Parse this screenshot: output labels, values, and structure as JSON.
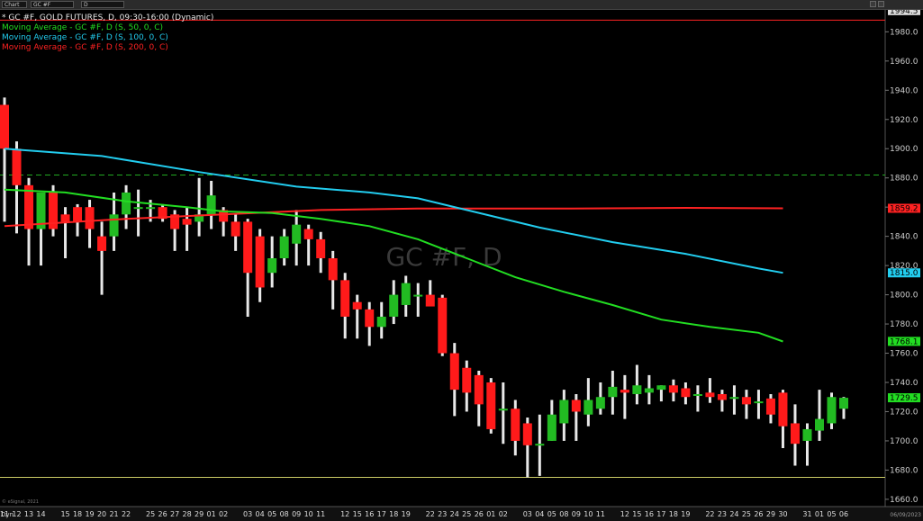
{
  "toolbar": {
    "chart_label": "Chart",
    "symbol": "GC #F",
    "interval": "D"
  },
  "legend": {
    "title": "* GC #F, GOLD FUTURES, D, 09:30-16:00 (Dynamic)",
    "ma50": "Moving Average - GC #F, D (S, 50, 0, C)",
    "ma100": "Moving Average - GC #F, D (S, 100, 0, C)",
    "ma200": "Moving Average - GC #F, D (S, 200, 0, C)"
  },
  "watermark": "GC #F, D",
  "copyright": "© eSignal, 2021",
  "footer": {
    "left": "Dyn",
    "right": "06/09/2023"
  },
  "price_tags": {
    "top": "1994.5",
    "ma200": "1859.2",
    "ma100": "1815.0",
    "ma50": "1768.1",
    "last": "1729.5"
  },
  "colors": {
    "up": "#22bb22",
    "down": "#ff1a1a",
    "wick": "#e8e8e8",
    "ma50": "#22dd22",
    "ma100": "#22ccee",
    "ma200": "#ff2222",
    "level_green": "#22aa22",
    "level_red": "#ff2222",
    "level_yellow": "#cccc66"
  },
  "chart_data": {
    "type": "candlestick",
    "ylim": [
      1655,
      1995
    ],
    "y_ticks": [
      1660,
      1680,
      1700,
      1720,
      1740,
      1760,
      1780,
      1800,
      1820,
      1840,
      1860,
      1880,
      1900,
      1920,
      1940,
      1960,
      1980
    ],
    "x_labels": [
      "11",
      "12",
      "13",
      "14",
      "15",
      "18",
      "19",
      "20",
      "21",
      "22",
      "25",
      "26",
      "27",
      "28",
      "29",
      "01",
      "02",
      "03",
      "04",
      "05",
      "08",
      "09",
      "10",
      "11",
      "12",
      "15",
      "16",
      "17",
      "18",
      "19",
      "22",
      "23",
      "24",
      "25",
      "26",
      "01",
      "02",
      "03",
      "04",
      "05",
      "08",
      "09",
      "10",
      "11",
      "12",
      "15",
      "16",
      "17",
      "18",
      "19",
      "22",
      "23",
      "24",
      "25",
      "26",
      "29",
      "30",
      "31",
      "01",
      "05",
      "06"
    ],
    "candles": [
      {
        "o": 1930,
        "h": 1935,
        "l": 1850,
        "c": 1900
      },
      {
        "o": 1900,
        "h": 1905,
        "l": 1842,
        "c": 1875
      },
      {
        "o": 1875,
        "h": 1880,
        "l": 1820,
        "c": 1845
      },
      {
        "o": 1845,
        "h": 1860,
        "l": 1820,
        "c": 1870
      },
      {
        "o": 1870,
        "h": 1875,
        "l": 1840,
        "c": 1845
      },
      {
        "o": 1855,
        "h": 1860,
        "l": 1825,
        "c": 1850
      },
      {
        "o": 1860,
        "h": 1862,
        "l": 1840,
        "c": 1850
      },
      {
        "o": 1860,
        "h": 1865,
        "l": 1832,
        "c": 1845
      },
      {
        "o": 1840,
        "h": 1850,
        "l": 1800,
        "c": 1830
      },
      {
        "o": 1840,
        "h": 1870,
        "l": 1830,
        "c": 1855
      },
      {
        "o": 1855,
        "h": 1875,
        "l": 1845,
        "c": 1870
      },
      {
        "o": 1860,
        "h": 1872,
        "l": 1840,
        "c": 1860
      },
      {
        "o": 1860,
        "h": 1865,
        "l": 1850,
        "c": 1860
      },
      {
        "o": 1860,
        "h": 1862,
        "l": 1850,
        "c": 1852
      },
      {
        "o": 1855,
        "h": 1858,
        "l": 1830,
        "c": 1845
      },
      {
        "o": 1852,
        "h": 1860,
        "l": 1830,
        "c": 1848
      },
      {
        "o": 1850,
        "h": 1880,
        "l": 1840,
        "c": 1855
      },
      {
        "o": 1855,
        "h": 1878,
        "l": 1845,
        "c": 1868
      },
      {
        "o": 1858,
        "h": 1860,
        "l": 1840,
        "c": 1850
      },
      {
        "o": 1850,
        "h": 1855,
        "l": 1830,
        "c": 1840
      },
      {
        "o": 1850,
        "h": 1852,
        "l": 1785,
        "c": 1815
      },
      {
        "o": 1840,
        "h": 1845,
        "l": 1795,
        "c": 1805
      },
      {
        "o": 1815,
        "h": 1840,
        "l": 1805,
        "c": 1825
      },
      {
        "o": 1825,
        "h": 1845,
        "l": 1820,
        "c": 1840
      },
      {
        "o": 1835,
        "h": 1858,
        "l": 1820,
        "c": 1848
      },
      {
        "o": 1845,
        "h": 1848,
        "l": 1820,
        "c": 1838
      },
      {
        "o": 1838,
        "h": 1843,
        "l": 1815,
        "c": 1825
      },
      {
        "o": 1825,
        "h": 1830,
        "l": 1790,
        "c": 1810
      },
      {
        "o": 1810,
        "h": 1815,
        "l": 1770,
        "c": 1785
      },
      {
        "o": 1795,
        "h": 1800,
        "l": 1770,
        "c": 1790
      },
      {
        "o": 1790,
        "h": 1795,
        "l": 1765,
        "c": 1778
      },
      {
        "o": 1778,
        "h": 1795,
        "l": 1770,
        "c": 1785
      },
      {
        "o": 1785,
        "h": 1810,
        "l": 1780,
        "c": 1800
      },
      {
        "o": 1793,
        "h": 1813,
        "l": 1785,
        "c": 1808
      },
      {
        "o": 1800,
        "h": 1808,
        "l": 1785,
        "c": 1800
      },
      {
        "o": 1800,
        "h": 1810,
        "l": 1795,
        "c": 1792
      },
      {
        "o": 1798,
        "h": 1800,
        "l": 1758,
        "c": 1760
      },
      {
        "o": 1760,
        "h": 1767,
        "l": 1717,
        "c": 1735
      },
      {
        "o": 1750,
        "h": 1755,
        "l": 1720,
        "c": 1733
      },
      {
        "o": 1745,
        "h": 1748,
        "l": 1710,
        "c": 1725
      },
      {
        "o": 1740,
        "h": 1743,
        "l": 1705,
        "c": 1708
      },
      {
        "o": 1722,
        "h": 1740,
        "l": 1698,
        "c": 1722
      },
      {
        "o": 1722,
        "h": 1728,
        "l": 1690,
        "c": 1700
      },
      {
        "o": 1712,
        "h": 1716,
        "l": 1675,
        "c": 1697
      },
      {
        "o": 1698,
        "h": 1718,
        "l": 1676,
        "c": 1698
      },
      {
        "o": 1700,
        "h": 1728,
        "l": 1700,
        "c": 1718
      },
      {
        "o": 1712,
        "h": 1735,
        "l": 1700,
        "c": 1728
      },
      {
        "o": 1728,
        "h": 1732,
        "l": 1700,
        "c": 1720
      },
      {
        "o": 1718,
        "h": 1743,
        "l": 1710,
        "c": 1728
      },
      {
        "o": 1722,
        "h": 1740,
        "l": 1718,
        "c": 1730
      },
      {
        "o": 1730,
        "h": 1748,
        "l": 1718,
        "c": 1737
      },
      {
        "o": 1735,
        "h": 1745,
        "l": 1715,
        "c": 1733
      },
      {
        "o": 1732,
        "h": 1752,
        "l": 1725,
        "c": 1738
      },
      {
        "o": 1733,
        "h": 1745,
        "l": 1725,
        "c": 1736
      },
      {
        "o": 1735,
        "h": 1738,
        "l": 1727,
        "c": 1738
      },
      {
        "o": 1738,
        "h": 1742,
        "l": 1727,
        "c": 1733
      },
      {
        "o": 1736,
        "h": 1740,
        "l": 1725,
        "c": 1730
      },
      {
        "o": 1732,
        "h": 1738,
        "l": 1720,
        "c": 1732
      },
      {
        "o": 1733,
        "h": 1743,
        "l": 1726,
        "c": 1730
      },
      {
        "o": 1732,
        "h": 1735,
        "l": 1720,
        "c": 1728
      },
      {
        "o": 1730,
        "h": 1738,
        "l": 1718,
        "c": 1730
      },
      {
        "o": 1730,
        "h": 1735,
        "l": 1715,
        "c": 1725
      },
      {
        "o": 1726,
        "h": 1735,
        "l": 1715,
        "c": 1727
      },
      {
        "o": 1729,
        "h": 1732,
        "l": 1712,
        "c": 1718
      },
      {
        "o": 1733,
        "h": 1735,
        "l": 1695,
        "c": 1710
      },
      {
        "o": 1712,
        "h": 1725,
        "l": 1683,
        "c": 1698
      },
      {
        "o": 1700,
        "h": 1712,
        "l": 1683,
        "c": 1708
      },
      {
        "o": 1707,
        "h": 1735,
        "l": 1700,
        "c": 1715
      },
      {
        "o": 1712,
        "h": 1733,
        "l": 1708,
        "c": 1730
      },
      {
        "o": 1722,
        "h": 1730,
        "l": 1715,
        "c": 1729.5
      }
    ],
    "ma50": [
      [
        0,
        1872
      ],
      [
        5,
        1870
      ],
      [
        10,
        1864
      ],
      [
        15,
        1860
      ],
      [
        18,
        1857
      ],
      [
        22,
        1856
      ],
      [
        26,
        1852
      ],
      [
        30,
        1847
      ],
      [
        34,
        1838
      ],
      [
        38,
        1825
      ],
      [
        42,
        1812
      ],
      [
        46,
        1802
      ],
      [
        50,
        1793
      ],
      [
        54,
        1783
      ],
      [
        58,
        1778
      ],
      [
        62,
        1774
      ],
      [
        64,
        1768
      ]
    ],
    "ma100": [
      [
        0,
        1900
      ],
      [
        8,
        1895
      ],
      [
        16,
        1884
      ],
      [
        24,
        1874
      ],
      [
        30,
        1870
      ],
      [
        34,
        1866
      ],
      [
        38,
        1858
      ],
      [
        44,
        1846
      ],
      [
        50,
        1836
      ],
      [
        56,
        1828
      ],
      [
        62,
        1818
      ],
      [
        64,
        1815
      ]
    ],
    "ma200": [
      [
        0,
        1847
      ],
      [
        10,
        1852
      ],
      [
        18,
        1855
      ],
      [
        26,
        1858
      ],
      [
        34,
        1859
      ],
      [
        46,
        1859
      ],
      [
        56,
        1859.5
      ],
      [
        64,
        1859.2
      ]
    ],
    "levels": [
      {
        "price": 1882,
        "style": "dashed",
        "color": "#22aa22"
      },
      {
        "price": 1988,
        "style": "solid",
        "color": "#ff2222"
      },
      {
        "price": 1675,
        "style": "solid",
        "color": "#cccc66"
      }
    ]
  }
}
